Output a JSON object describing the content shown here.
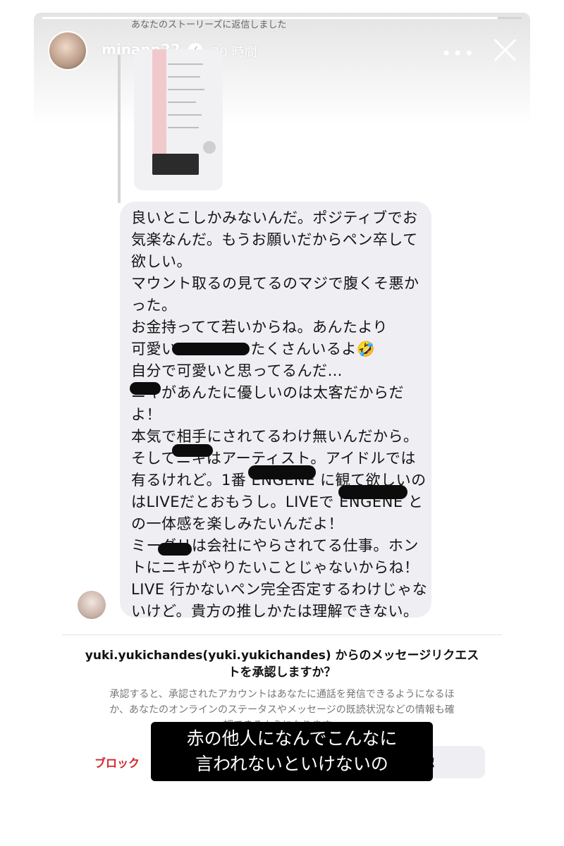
{
  "story": {
    "reply_note": "あなたのストーリーズに返信しました",
    "username": "minann22",
    "verified_badge": "✓",
    "time": "20 時間",
    "more_icon": "more-dots-icon",
    "close_icon": "close-icon",
    "progress": 0.95
  },
  "message": {
    "lines": [
      "良いとこしかみないんだ。ポジティブでお",
      "気楽なんだ。もうお願いだからペン卒して",
      "欲しい。",
      "マウント取るの見てるのマジで腹くそ悪か",
      "った。",
      "お金持ってて若いからね。あんたより",
      "可愛い ENGENE たくさんいるよ🤣",
      "自分で可愛いと思ってるんだ…",
      "ニキがあんたに優しいのは太客だからだ",
      "よ！",
      "本気で相手にされてるわけ無いんだから。",
      "そしてニキはアーティスト。アイドルでは",
      "有るけれど。1番 ENGENE に観て欲しいの",
      "はLIVEだとおもうし。LIVEで ENGENE と",
      "の一体感を楽しみたいんだよ！",
      "ミーグリは会社にやらされてる仕事。ホン",
      "トにニキがやりたいことじゃないからね！",
      "LIVE 行かないペン完全否定するわけじゃな",
      "いけど。貴方の推しかたは理解できない。"
    ]
  },
  "request": {
    "title_line1": "yuki.yukichandes(yuki.yukichandes) からのメッセージリクエス",
    "title_line2": "トを承認しますか？",
    "desc_line1": "承認すると、承認されたアカウントはあなたに通話を発信できるようになるほ",
    "desc_line2": "か、あなたのオンラインのステータスやメッセージの既読状況などの情報も確",
    "desc_line3": "認できるようになります。",
    "block_label": "ブロック",
    "approve_label": "承認"
  },
  "caption": {
    "line1": "赤の他人になんでこんなに",
    "line2": "言われないといけないの"
  },
  "colors": {
    "bubble": "#efeff3",
    "block_red": "#d1272c",
    "caption_bg": "#000000"
  }
}
